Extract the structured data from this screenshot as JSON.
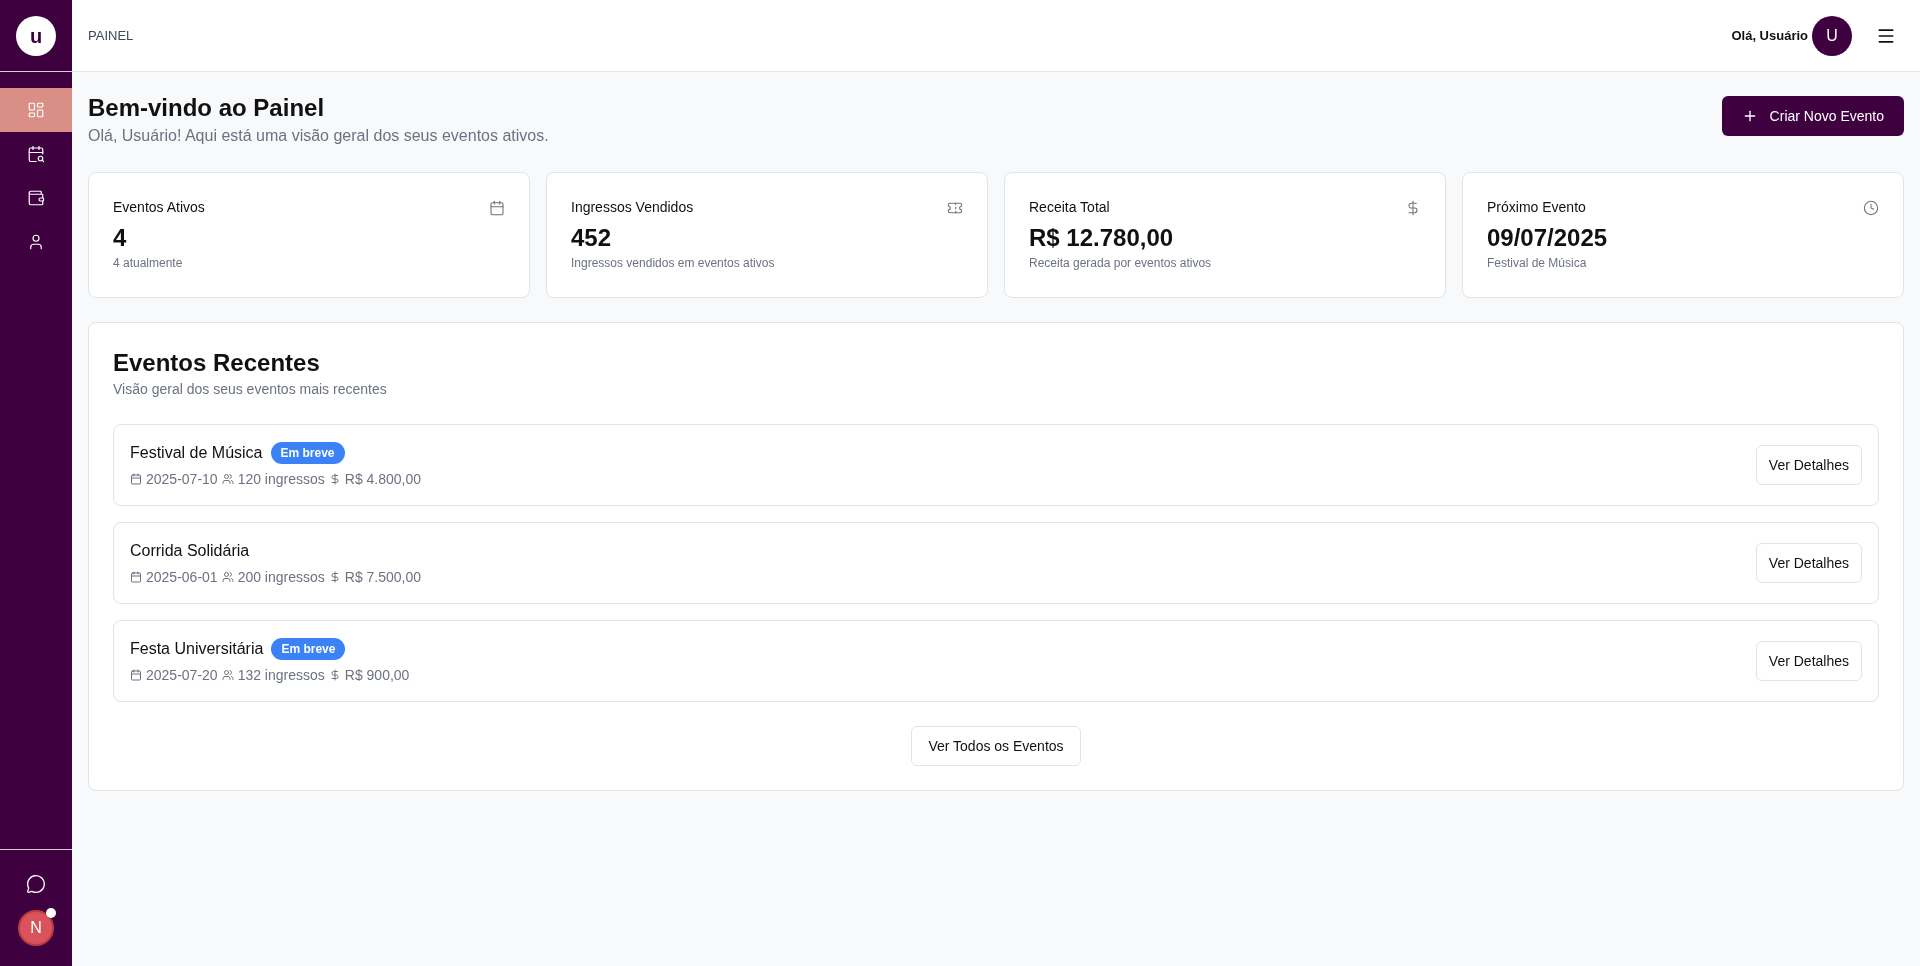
{
  "sidebar": {
    "logo": "u",
    "items": [
      {
        "kind": "dashboard",
        "selected": true
      },
      {
        "kind": "calendar",
        "selected": false
      },
      {
        "kind": "wallet",
        "selected": false
      },
      {
        "kind": "user",
        "selected": false
      }
    ],
    "avatar": {
      "initial": "N",
      "notification": true
    }
  },
  "header": {
    "breadcrumb": "PAINEL",
    "greeting": "Olá, Usuário",
    "avatar": "U"
  },
  "page": {
    "title": "Bem-vindo ao Painel",
    "subtitle": "Olá, Usuário! Aqui está uma visão geral dos seus eventos ativos.",
    "create_button": "Criar Novo Evento"
  },
  "stats": [
    {
      "kind": "calendar",
      "label": "Eventos Ativos",
      "value": "4",
      "note": "4 atualmente"
    },
    {
      "kind": "ticket",
      "label": "Ingressos Vendidos",
      "value": "452",
      "note": "Ingressos vendidos em eventos ativos"
    },
    {
      "kind": "dollar",
      "label": "Receita Total",
      "value": "R$ 12.780,00",
      "note": "Receita gerada por eventos ativos"
    },
    {
      "kind": "clock",
      "label": "Próximo Evento",
      "value": "09/07/2025",
      "note": "Festival de Música"
    }
  ],
  "recent": {
    "title": "Eventos Recentes",
    "subtitle": "Visão geral dos seus eventos mais recentes",
    "events": [
      {
        "name": "Festival de Música",
        "badge": "Em breve",
        "date": "2025-07-10",
        "tickets": "120 ingressos",
        "revenue": "R$ 4.800,00",
        "button": "Ver Detalhes"
      },
      {
        "name": "Corrida Solidária",
        "date": "2025-06-01",
        "tickets": "200 ingressos",
        "revenue": "R$ 7.500,00",
        "button": "Ver Detalhes"
      },
      {
        "name": "Festa Universitária",
        "badge": "Em breve",
        "date": "2025-07-20",
        "tickets": "132 ingressos",
        "revenue": "R$ 900,00",
        "button": "Ver Detalhes"
      }
    ],
    "all_button": "Ver Todos os Eventos"
  }
}
